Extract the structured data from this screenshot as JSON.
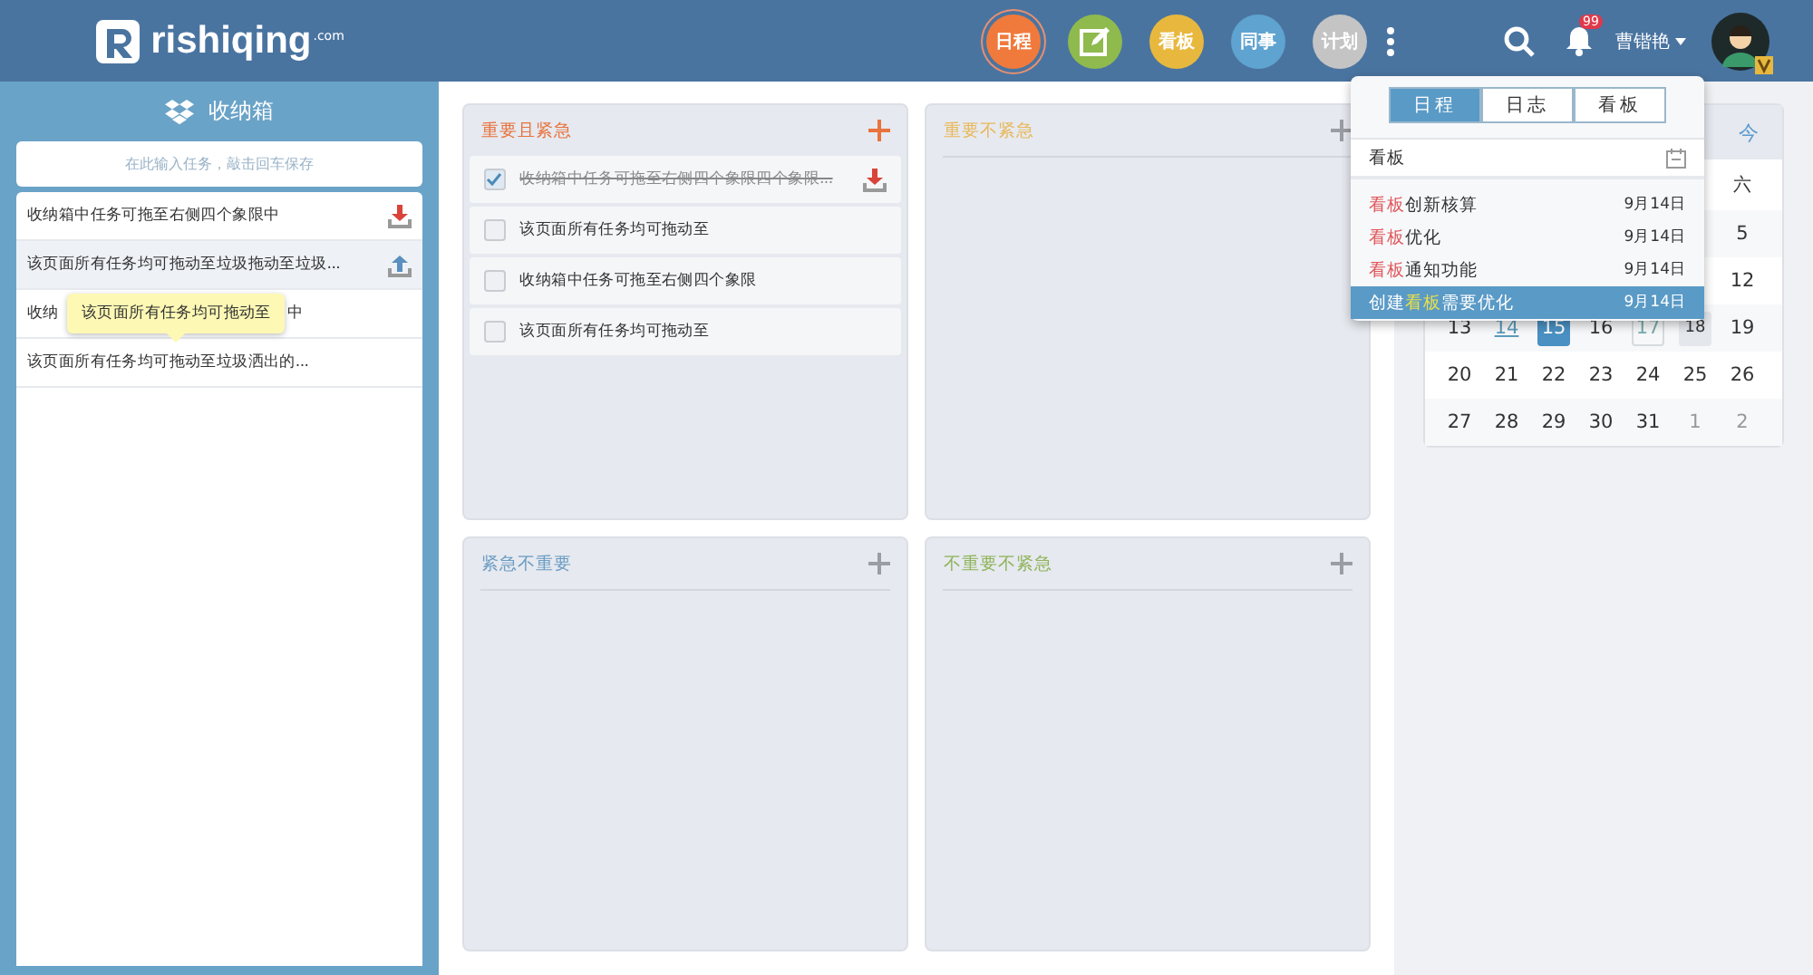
{
  "header": {
    "logo": "rishiqing",
    "logo_suffix": ".com",
    "nav": [
      {
        "kind": "text",
        "label": "日程",
        "color": "#f07a3c",
        "selected": true
      },
      {
        "kind": "pencil",
        "color": "#8fba4e",
        "selected": false
      },
      {
        "kind": "text",
        "label": "看板",
        "color": "#e8b83e",
        "selected": false
      },
      {
        "kind": "text",
        "label": "同事",
        "color": "#5fa3d0",
        "selected": false
      },
      {
        "kind": "text",
        "label": "计划",
        "color": "#c4c4c4",
        "selected": false
      }
    ],
    "notification_count": "99",
    "user_name": "曹锴艳"
  },
  "inbox": {
    "title": "收纳箱",
    "placeholder": "在此输入任务，敲击回车保存",
    "items": [
      {
        "kind": "download",
        "fragments": [
          "收纳箱中任务可拖至右侧四个象限中"
        ],
        "hovered": false
      },
      {
        "kind": "upload",
        "fragments": [
          "该页面所有任务均可拖动至垃圾拖动至垃圾..."
        ],
        "hovered": true
      },
      {
        "kind": "plain",
        "fragments": [
          "收纳",
          "中"
        ],
        "hovered": false
      },
      {
        "kind": "plain",
        "fragments": [
          "该页面所有任务均可拖动至垃圾洒出的..."
        ],
        "hovered": false
      }
    ],
    "tooltip": "该页面所有任务均可拖动至"
  },
  "quadrants": [
    {
      "title": "重要且紧急",
      "color": "#e8733e",
      "tasks": [
        {
          "text": "收纳箱中任务可拖至右侧四个象限四个象限...",
          "checked": true
        },
        {
          "text": "该页面所有任务均可拖动至",
          "checked": false
        },
        {
          "text": "收纳箱中任务可拖至右侧四个象限",
          "checked": false
        },
        {
          "text": "该页面所有任务均可拖动至",
          "checked": false
        }
      ]
    },
    {
      "title": "重要不紧急",
      "color": "#e8b85a"
    },
    {
      "title": "紧急不重要",
      "color": "#6b9cc4"
    },
    {
      "title": "不重要不紧急",
      "color": "#8fb35a"
    }
  ],
  "calendar": {
    "today_button": "今",
    "weekdays": [
      "六"
    ],
    "weeks": [
      [
        {
          "day": "5",
          "kind": "normal"
        }
      ],
      [
        {
          "day": "12",
          "kind": "normal"
        }
      ],
      [
        {
          "day": "13",
          "kind": "normal"
        },
        {
          "day": "14",
          "kind": "underlined"
        },
        {
          "day": "15",
          "kind": "selected"
        },
        {
          "day": "16",
          "kind": "normal"
        },
        {
          "day": "17",
          "kind": "outlined"
        },
        {
          "day": "18",
          "kind": "shaded"
        },
        {
          "day": "19",
          "kind": "normal"
        }
      ],
      [
        {
          "day": "20",
          "kind": "normal"
        },
        {
          "day": "21",
          "kind": "normal"
        },
        {
          "day": "22",
          "kind": "normal"
        },
        {
          "day": "23",
          "kind": "normal"
        },
        {
          "day": "24",
          "kind": "normal"
        },
        {
          "day": "25",
          "kind": "normal"
        },
        {
          "day": "26",
          "kind": "normal"
        }
      ],
      [
        {
          "day": "27",
          "kind": "normal"
        },
        {
          "day": "28",
          "kind": "normal"
        },
        {
          "day": "29",
          "kind": "normal"
        },
        {
          "day": "30",
          "kind": "normal"
        },
        {
          "day": "31",
          "kind": "normal"
        },
        {
          "day": "1",
          "kind": "other_month"
        },
        {
          "day": "2",
          "kind": "other_month"
        }
      ]
    ]
  },
  "search_popup": {
    "tabs": [
      {
        "label": "日程",
        "selected": true
      },
      {
        "label": "日志",
        "selected": false
      },
      {
        "label": "看板",
        "selected": false
      }
    ],
    "query": "看板",
    "results": [
      {
        "segments": [
          {
            "text": "看板",
            "match": true
          },
          {
            "text": "创新核算",
            "match": false
          }
        ],
        "date": "9月14日",
        "selected": false
      },
      {
        "segments": [
          {
            "text": "看板",
            "match": true
          },
          {
            "text": "优化",
            "match": false
          }
        ],
        "date": "9月14日",
        "selected": false
      },
      {
        "segments": [
          {
            "text": "看板",
            "match": true
          },
          {
            "text": "通知功能",
            "match": false
          }
        ],
        "date": "9月14日",
        "selected": false
      },
      {
        "segments": [
          {
            "text": "创建",
            "match": false
          },
          {
            "text": "看板",
            "match": true
          },
          {
            "text": "需要优化",
            "match": false
          }
        ],
        "date": "9月14日",
        "selected": true
      }
    ]
  }
}
